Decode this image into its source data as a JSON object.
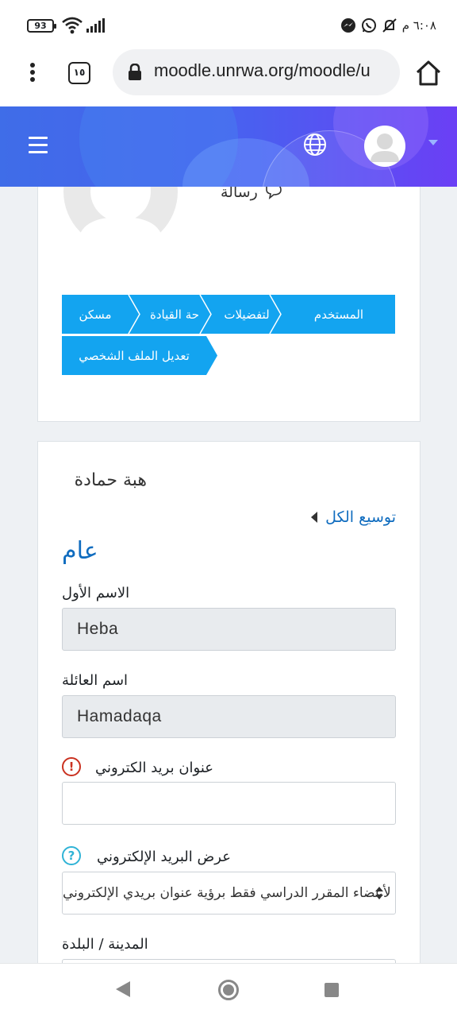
{
  "status_bar": {
    "battery": "93",
    "time": "٦:٠٨ م"
  },
  "browser": {
    "tab_count": "١٥",
    "url": "moodle.unrwa.org/moodle/u"
  },
  "header": {
    "icons": [
      "hamburger-menu-icon",
      "globe-icon",
      "user-avatar-icon",
      "chevron-down-icon"
    ]
  },
  "profile": {
    "message_label": "رسالة"
  },
  "breadcrumb": {
    "items": [
      "المستخدم",
      "لتفضيلات",
      "حة القيادة",
      "مسكن",
      "تعديل الملف الشخصي"
    ]
  },
  "form": {
    "full_name": "هبة حمادة",
    "expand_all": "توسيع الكل",
    "section_title": "عام",
    "first_name_label": "الاسم الأول",
    "first_name_value": "Heba",
    "last_name_label": "اسم العائلة",
    "last_name_value": "Hamadaqa",
    "email_label": "عنوان بريد الكتروني",
    "email_value": "",
    "required_symbol": "!",
    "email_display_label": "عرض البريد الإلكتروني",
    "help_symbol": "?",
    "email_display_value": "السماح لأعضاء المقرر الدراسي فقط برؤية عنوان بريدي الإلكتروني",
    "city_label": "المدينة / البلدة"
  },
  "colors": {
    "header_start": "#3f6de8",
    "header_end": "#6b3ff5",
    "breadcrumb": "#13a4f0",
    "link": "#0f6cbf",
    "required": "#ca3120",
    "help": "#2fb3d6"
  }
}
